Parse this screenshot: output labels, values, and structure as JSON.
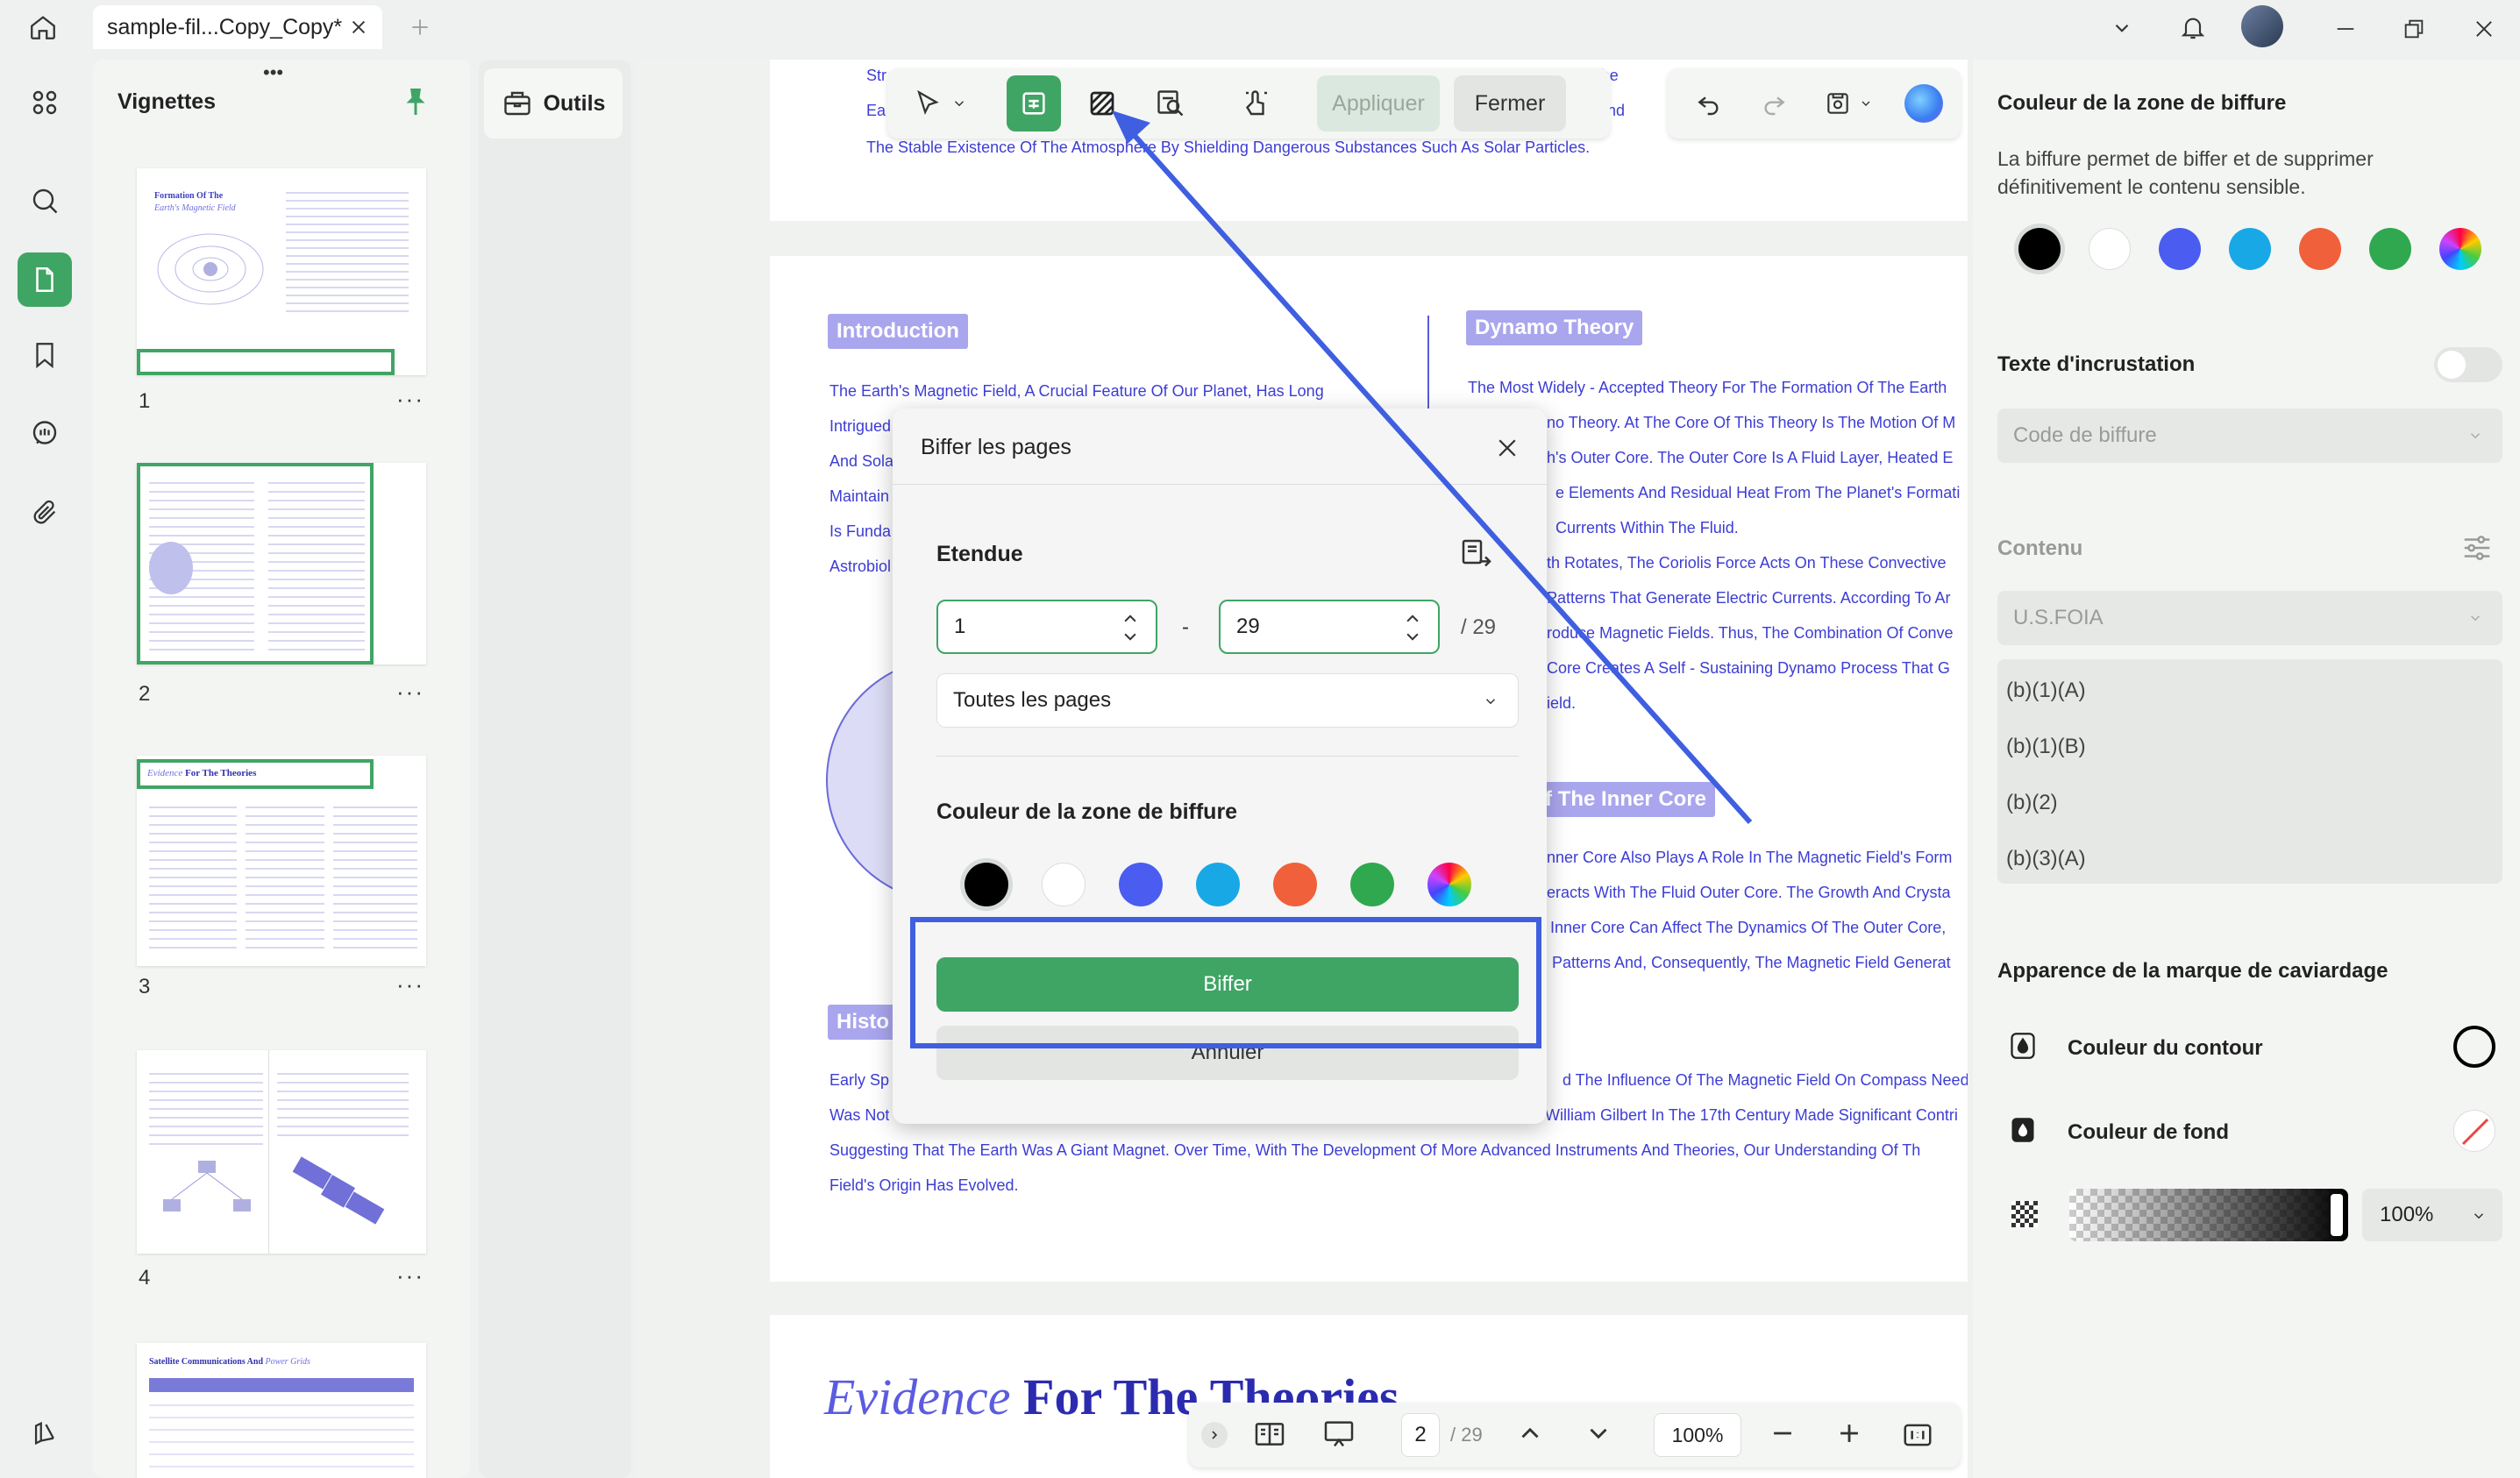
{
  "titlebar": {
    "tab_label": "sample-fil...Copy_Copy*",
    "icons": [
      "home-icon",
      "close-icon",
      "plus-icon",
      "chevron-down-icon",
      "bell-icon",
      "avatar",
      "minimize-icon",
      "maximize-icon",
      "close-window-icon"
    ]
  },
  "thumbnails": {
    "title": "Vignettes",
    "pages": [
      {
        "num": "1",
        "title_a": "Formation Of The",
        "title_b": "Earth's Magnetic Field"
      },
      {
        "num": "2"
      },
      {
        "num": "3",
        "title_a": "Evidence",
        "title_b": "For The Theories"
      },
      {
        "num": "4"
      },
      {
        "num": "",
        "title_a": "Satellite Communications And",
        "title_b": "Power Grids"
      }
    ],
    "more": "···"
  },
  "outils": {
    "label": "Outils"
  },
  "toolbar": {
    "apply": "Appliquer",
    "close": "Fermer"
  },
  "document": {
    "top_lines": [
      "Str",
      "Ea",
      "The Stable Existence Of The Atmosphere By Shielding Dangerous Substances Such As Solar Particles."
    ],
    "top_right": [
      "That The",
      "Earth And"
    ],
    "intro_badge": "Introduction",
    "intro_lines": [
      "The Earth's Magnetic Field, A Crucial Feature Of Our Planet, Has Long",
      "Intrigued",
      "And Sola",
      "Maintain",
      "Is Funda",
      "Astrobiol"
    ],
    "dynamo_badge": "Dynamo Theory",
    "dynamo_lines": [
      "The Most Widely - Accepted Theory For The Formation Of The Earth",
      "no Theory. At The Core Of This Theory Is The Motion Of M",
      "h's Outer Core. The Outer Core Is A Fluid Layer, Heated E",
      "e Elements And Residual Heat From The Planet's Formati",
      "Currents Within The Fluid.",
      "th Rotates, The Coriolis Force Acts On These Convective",
      "Patterns That Generate Electric Currents. According To Ar",
      "roduce Magnetic Fields. Thus, The Combination Of Conve",
      "Core Creates A Self - Sustaining Dynamo Process That G",
      "ield."
    ],
    "inner_badge": "f The Inner Core",
    "inner_lines": [
      "nner Core Also Plays A Role In The Magnetic Field's Form",
      "eracts With The Fluid Outer Core. The Growth And Crysta",
      "Inner Core Can Affect The Dynamics Of The Outer Core,",
      "Patterns And, Consequently, The Magnetic Field Generat"
    ],
    "histo_badge": "Histo",
    "histo_lines": [
      "Early Sp",
      "Was Not"
    ],
    "histo_right": [
      "d The Influence Of The Magnetic Field On Compass Need",
      "William Gilbert In The 17th Century Made Significant Contri"
    ],
    "bottom_lines": [
      "Suggesting That The Earth Was A Giant Magnet. Over Time, With The Development Of More Advanced Instruments And Theories, Our Understanding Of Th",
      "Field's Origin Has Evolved."
    ],
    "page3_title_a": "Evidence",
    "page3_title_b": "For The Theories"
  },
  "dialog": {
    "title": "Biffer les pages",
    "range_label": "Etendue",
    "from": "1",
    "to": "29",
    "dash": "-",
    "total": "/ 29",
    "pages_select": "Toutes les pages",
    "color_label": "Couleur de la zone de biffure",
    "colors": [
      "#000000",
      "#ffffff",
      "#4b5cf0",
      "#19a8e6",
      "#f0603a",
      "#2fa84f",
      "conic"
    ],
    "submit": "Biffer",
    "cancel": "Annuler"
  },
  "right_panel": {
    "color_title": "Couleur de la zone de biffure",
    "description_1": "La biffure permet de biffer et de supprimer",
    "description_2": "définitivement le contenu sensible.",
    "colors": [
      "#000000",
      "#ffffff",
      "#4b5cf0",
      "#19a8e6",
      "#f0603a",
      "#2fa84f",
      "conic"
    ],
    "overlay_title": "Texte d'incrustation",
    "overlay_toggle": "off",
    "code_placeholder": "Code de biffure",
    "content_title": "Contenu",
    "content_select": "U.S.FOIA",
    "codes": [
      "(b)(1)(A)",
      "(b)(1)(B)",
      "(b)(2)",
      "(b)(3)(A)"
    ],
    "appearance_title": "Apparence de la marque de caviardage",
    "outline_label": "Couleur du contour",
    "fill_label": "Couleur de fond",
    "opacity": "100%"
  },
  "bottombar": {
    "page": "2",
    "total": "/ 29",
    "zoom": "100%"
  },
  "colors": {
    "accent": "#3fa564",
    "highlight": "#3f5fe0",
    "doc_text": "#3d3dd6"
  }
}
